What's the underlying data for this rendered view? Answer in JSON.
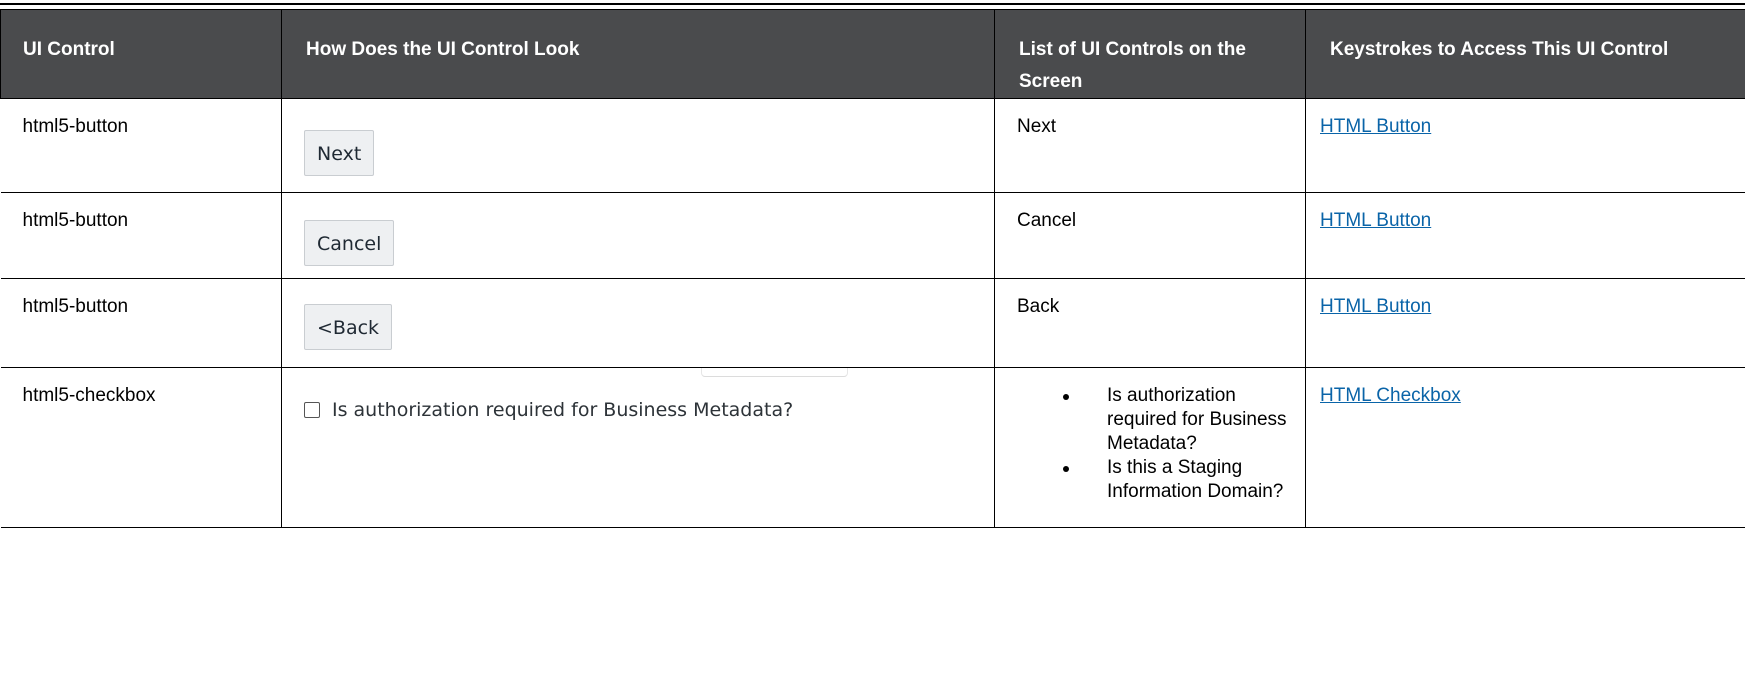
{
  "table": {
    "headers": [
      "UI Control",
      "How Does the UI Control Look",
      "List of UI Controls on the Screen",
      "Keystrokes to Access This UI Control"
    ],
    "rows": [
      {
        "control": "html5-button",
        "look_label": "Next",
        "list": "Next",
        "keystroke_link": "HTML Button"
      },
      {
        "control": "html5-button",
        "look_label": "Cancel",
        "list": "Cancel",
        "keystroke_link": "HTML Button"
      },
      {
        "control": "html5-button",
        "look_label": "<Back",
        "list": "Back",
        "keystroke_link": "HTML Button"
      },
      {
        "control": "html5-checkbox",
        "look_label": "Is authorization required for Business Metadata?",
        "list_items": [
          "Is authorization required for Business Metadata?",
          "Is this a Staging Information Domain?"
        ],
        "keystroke_link": "HTML Checkbox"
      }
    ]
  },
  "colors": {
    "header_bg": "#4a4b4d",
    "link": "#0a64a8"
  }
}
